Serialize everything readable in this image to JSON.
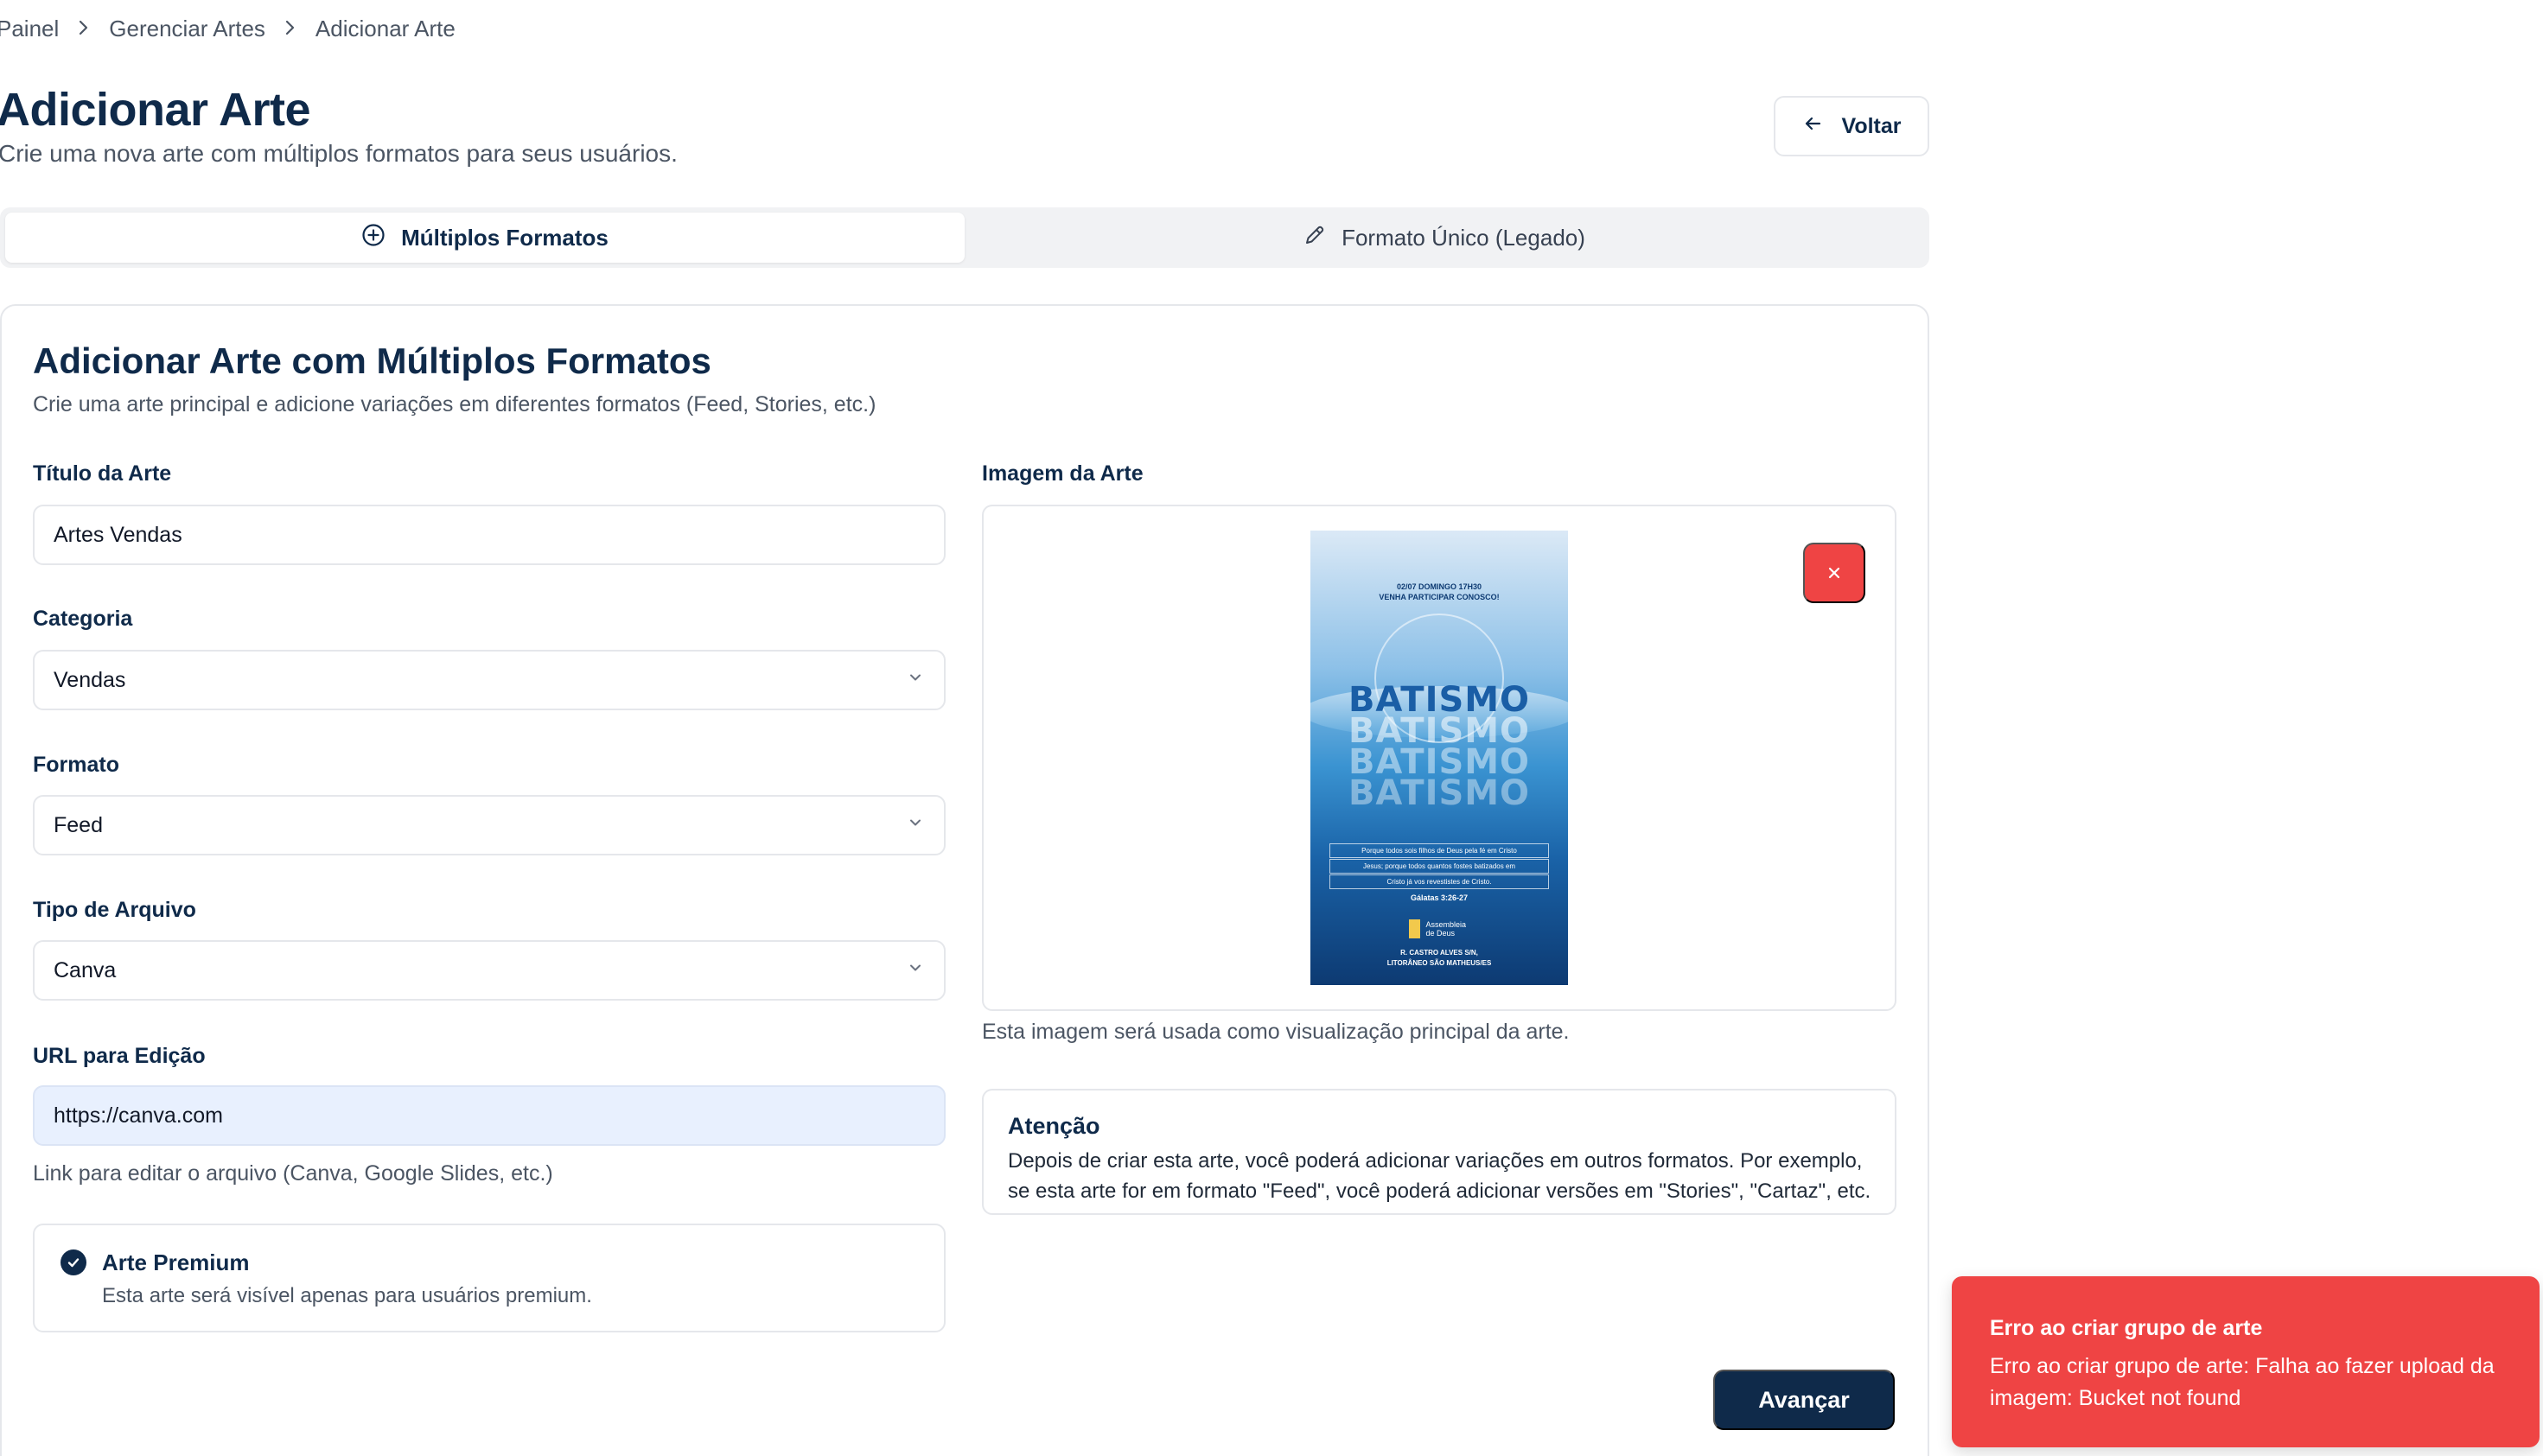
{
  "breadcrumb": {
    "items": [
      "Painel",
      "Gerenciar Artes",
      "Adicionar Arte"
    ]
  },
  "header": {
    "title": "Adicionar Arte",
    "subtitle": "Crie uma nova arte com múltiplos formatos para seus usuários.",
    "back_label": "Voltar"
  },
  "tabs": [
    {
      "label": "Múltiplos Formatos",
      "active": true,
      "icon": "plus-circle-icon"
    },
    {
      "label": "Formato Único (Legado)",
      "active": false,
      "icon": "pencil-icon"
    }
  ],
  "form": {
    "title": "Adicionar Arte com Múltiplos Formatos",
    "description": "Crie uma arte principal e adicione variações em diferentes formatos (Feed, Stories, etc.)",
    "titulo": {
      "label": "Título da Arte",
      "value": "Artes Vendas"
    },
    "categoria": {
      "label": "Categoria",
      "value": "Vendas"
    },
    "formato": {
      "label": "Formato",
      "value": "Feed"
    },
    "tipo_arquivo": {
      "label": "Tipo de Arquivo",
      "value": "Canva"
    },
    "url": {
      "label": "URL para Edição",
      "value": "https://canva.com",
      "hint": "Link para editar o arquivo (Canva, Google Slides, etc.)"
    },
    "premium": {
      "checked": true,
      "title": "Arte Premium",
      "description": "Esta arte será visível apenas para usuários premium."
    },
    "imagem": {
      "label": "Imagem da Arte",
      "hint": "Esta imagem será usada como visualização principal da arte."
    },
    "attention": {
      "title": "Atenção",
      "text": "Depois de criar esta arte, você poderá adicionar variações em outros formatos. Por exemplo, se esta arte for em formato \"Feed\", você poderá adicionar versões em \"Stories\", \"Cartaz\", etc."
    },
    "next_label": "Avançar"
  },
  "poster": {
    "line1": "02/07 DOMINGO 17H30",
    "line2": "VENHA PARTICIPAR CONOSCO!",
    "word": "BATISMO",
    "verse1": "Porque todos sois filhos de Deus pela fé em Cristo",
    "verse2": "Jesus; porque todos quantos fostes batizados em",
    "verse3": "Cristo já vos revestistes de Cristo.",
    "ref": "Gálatas 3:26-27",
    "logo_text": "Assembleia de Deus",
    "foot1": "R. CASTRO ALVES S/N,",
    "foot2": "LITORÂNEO SÃO MATHEUS/ES"
  },
  "toast": {
    "title": "Erro ao criar grupo de arte",
    "message": "Erro ao criar grupo de arte: Falha ao fazer upload da imagem: Bucket not found"
  },
  "colors": {
    "primary": "#0f2a4a",
    "danger": "#ef4444",
    "url_bg": "#e8f0fe"
  }
}
